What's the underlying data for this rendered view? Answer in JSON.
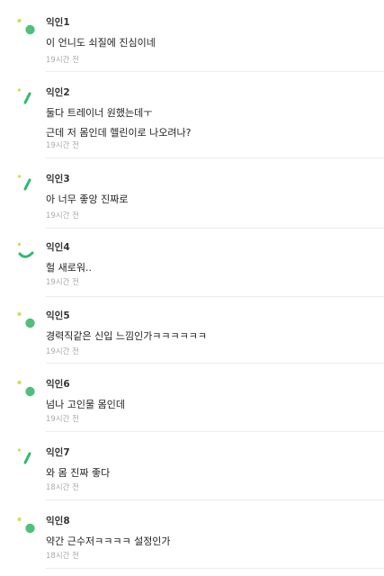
{
  "colors": {
    "accent_green": "#2fba6a",
    "time_gray": "#aaaaaa",
    "divider": "#ececec"
  },
  "comments": [
    {
      "author": "익인1",
      "lines": [
        "이 언니도 쇠질에 진심이네"
      ],
      "time": "19시간 전",
      "avatar_icon": "dot-avatar-icon"
    },
    {
      "author": "익인2",
      "lines": [
        "둘다 트레이너 원했는데ㅜ",
        "근데 저 몸인데 헬린이로 나오려나?"
      ],
      "time": "19시간 전",
      "avatar_icon": "slash-avatar-icon"
    },
    {
      "author": "익인3",
      "lines": [
        "아 너무 좋앙 진짜로"
      ],
      "time": "19시간 전",
      "avatar_icon": "slash-avatar-icon"
    },
    {
      "author": "익인4",
      "lines": [
        "헐 새로워.."
      ],
      "time": "19시간 전",
      "avatar_icon": "arc-avatar-icon"
    },
    {
      "author": "익인5",
      "lines": [
        "경력직같은 신입 느낌인가ㅋㅋㅋㅋㅋㅋ"
      ],
      "time": "19시간 전",
      "avatar_icon": "dot-avatar-icon"
    },
    {
      "author": "익인6",
      "lines": [
        "넘나 고인물 몸인데"
      ],
      "time": "19시간 전",
      "avatar_icon": "dot-avatar-icon"
    },
    {
      "author": "익인7",
      "lines": [
        "와 몸 진짜 좋다"
      ],
      "time": "18시간 전",
      "avatar_icon": "slash-avatar-icon"
    },
    {
      "author": "익인8",
      "lines": [
        "약간 근수저ㅋㅋㅋㅋ 설정인가"
      ],
      "time": "18시간 전",
      "avatar_icon": "dot-avatar-icon"
    }
  ]
}
